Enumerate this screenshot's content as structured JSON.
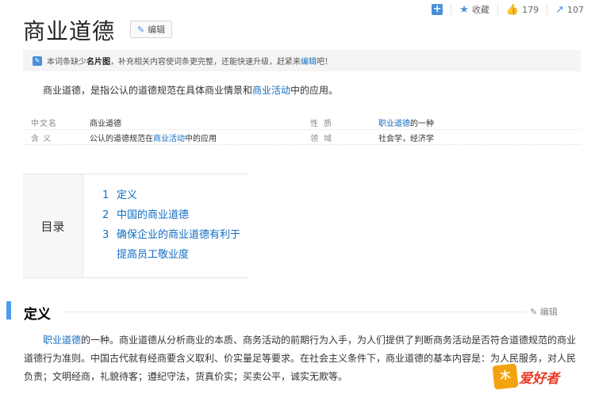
{
  "topbar": {
    "favorite_label": "收藏",
    "like_count": "179",
    "share_count": "107"
  },
  "title": "商业道德",
  "edit_button_label": "编辑",
  "notice": {
    "prefix": "本词条缺少",
    "missing": "名片图",
    "middle": "，补充相关内容使词条更完整，还能快速升级，赶紧来",
    "link": "编辑",
    "suffix": "吧！"
  },
  "summary": {
    "prefix": "商业道德，是指公认的道德规范在具体商业情景和",
    "link": "商业活动",
    "suffix": "中的应用。"
  },
  "info": {
    "rows": [
      {
        "k1": "中文名",
        "v1": "商业道德",
        "v1_link": "",
        "v1_suffix": "",
        "k2": "性 质",
        "v2_link": "职业道德",
        "v2": "的一种"
      },
      {
        "k1": "含 义",
        "v1": "公认的道德规范在",
        "v1_link": "商业活动",
        "v1_suffix": "中的应用",
        "k2": "领 域",
        "v2_link": "",
        "v2": "社会学，经济学"
      }
    ]
  },
  "toc": {
    "label": "目录",
    "items": [
      {
        "num": "1",
        "text": "定义"
      },
      {
        "num": "2",
        "text": "中国的商业道德"
      },
      {
        "num": "3",
        "text": "确保企业的商业道德有利于提高员工敬业度"
      }
    ]
  },
  "section": {
    "title": "定义",
    "edit_label": "编辑",
    "link": "职业道德",
    "text": "的一种。商业道德从分析商业的本质、商务活动的前期行为入手，为人们提供了判断商务活动是否符合道德规范的商业道德行为准则。中国古代就有经商要含义取利、价实量足等要求。在社会主义条件下，商业道德的基本内容是：为人民服务，对人民负责；文明经商，礼貌待客；遵纪守法，货真价实；买卖公平，诚实无欺等。"
  },
  "watermark": {
    "mark": "木",
    "text": "爱好者"
  },
  "colors": {
    "accent": "#136ec2",
    "section_bar": "#4f9cee",
    "watermark_red": "#e83a24"
  }
}
